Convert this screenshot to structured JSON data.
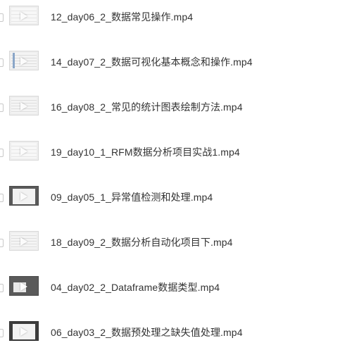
{
  "files": [
    {
      "name": "12_day06_2_数据常见操作.mp4",
      "thumbnail": "spreadsheet-video"
    },
    {
      "name": "14_day07_2_数据可视化基本概念和操作.mp4",
      "thumbnail": "spreadsheet-video"
    },
    {
      "name": "16_day08_2_常见的统计图表绘制方法.mp4",
      "thumbnail": "spreadsheet-video"
    },
    {
      "name": "19_day10_1_RFM数据分析项目实战1.mp4",
      "thumbnail": "spreadsheet-video"
    },
    {
      "name": "09_day05_1_异常值检测和处理.mp4",
      "thumbnail": "dark-screen-video"
    },
    {
      "name": "18_day09_2_数据分析自动化项目下.mp4",
      "thumbnail": "spreadsheet-video"
    },
    {
      "name": "04_day02_2_Dataframe数据类型.mp4",
      "thumbnail": "dark-screen-video"
    },
    {
      "name": "06_day03_2_数据预处理之缺失值处理.mp4",
      "thumbnail": "dark-frame-video"
    }
  ]
}
